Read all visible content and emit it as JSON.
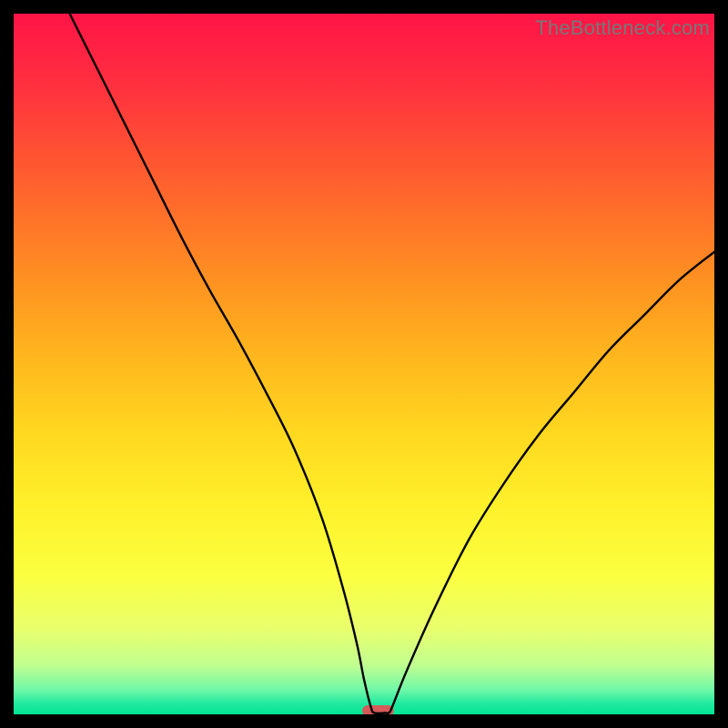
{
  "watermark": "TheBottleneck.com",
  "chart_data": {
    "type": "line",
    "title": "",
    "xlabel": "",
    "ylabel": "",
    "xlim": [
      0,
      100
    ],
    "ylim": [
      0,
      100
    ],
    "series": [
      {
        "name": "bottleneck-curve",
        "x": [
          8,
          12,
          16,
          20,
          24,
          28,
          32,
          36,
          40,
          44,
          47,
          49,
          50,
          51,
          51.5,
          53,
          53.5,
          54,
          56,
          60,
          65,
          70,
          75,
          80,
          85,
          90,
          95,
          100
        ],
        "y": [
          100,
          92,
          84,
          76,
          68,
          60.5,
          53.5,
          46,
          38,
          28,
          18,
          10,
          5,
          1,
          0.2,
          0.2,
          0.2,
          1,
          6,
          15,
          25,
          33,
          40,
          46,
          52,
          57,
          62,
          66
        ]
      }
    ],
    "background_gradient": {
      "stops": [
        {
          "offset": 0.0,
          "color": "#ff1447"
        },
        {
          "offset": 0.1,
          "color": "#ff2f3f"
        },
        {
          "offset": 0.2,
          "color": "#ff5233"
        },
        {
          "offset": 0.3,
          "color": "#ff7528"
        },
        {
          "offset": 0.4,
          "color": "#ff9820"
        },
        {
          "offset": 0.5,
          "color": "#ffba1e"
        },
        {
          "offset": 0.6,
          "color": "#ffd820"
        },
        {
          "offset": 0.7,
          "color": "#fff02a"
        },
        {
          "offset": 0.8,
          "color": "#fbff3f"
        },
        {
          "offset": 0.88,
          "color": "#e8ff6e"
        },
        {
          "offset": 0.93,
          "color": "#c0ff90"
        },
        {
          "offset": 0.965,
          "color": "#70f8a8"
        },
        {
          "offset": 0.985,
          "color": "#20e9a0"
        },
        {
          "offset": 1.0,
          "color": "#00e592"
        }
      ]
    },
    "marker": {
      "x": 52.0,
      "y": 0.5,
      "width": 4.5,
      "height": 1.6,
      "color": "#d65a5a"
    }
  }
}
